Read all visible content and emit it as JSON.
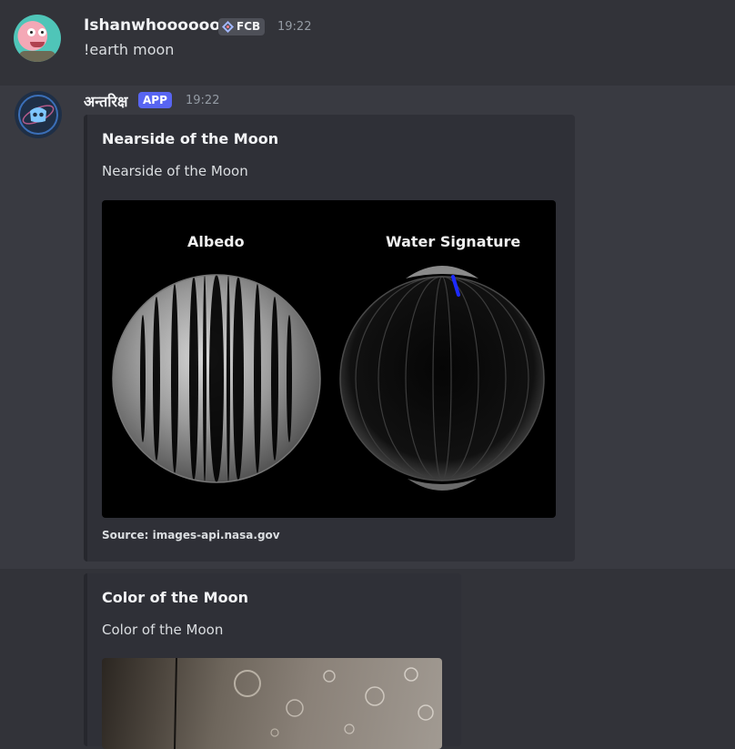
{
  "message1": {
    "author": "Ishanwhoooooo?",
    "tag": "FCB",
    "time": "19:22",
    "content": "!earth moon"
  },
  "message2": {
    "author": "अन्तरिक्ष",
    "badge": "APP",
    "time": "19:22",
    "embed": {
      "title": "Nearside of the Moon",
      "description": "Nearside of the Moon",
      "image_labels": [
        "Albedo",
        "Water Signature"
      ],
      "footer": "Source: images-api.nasa.gov"
    }
  },
  "message3": {
    "embed": {
      "title": "Color of the Moon",
      "description": "Color of the Moon"
    }
  },
  "colors": {
    "bg": "#323339",
    "highlight": "#393a41",
    "embed_bg": "#2f3037",
    "app_badge": "#5865f2",
    "muted": "#949ba4"
  }
}
